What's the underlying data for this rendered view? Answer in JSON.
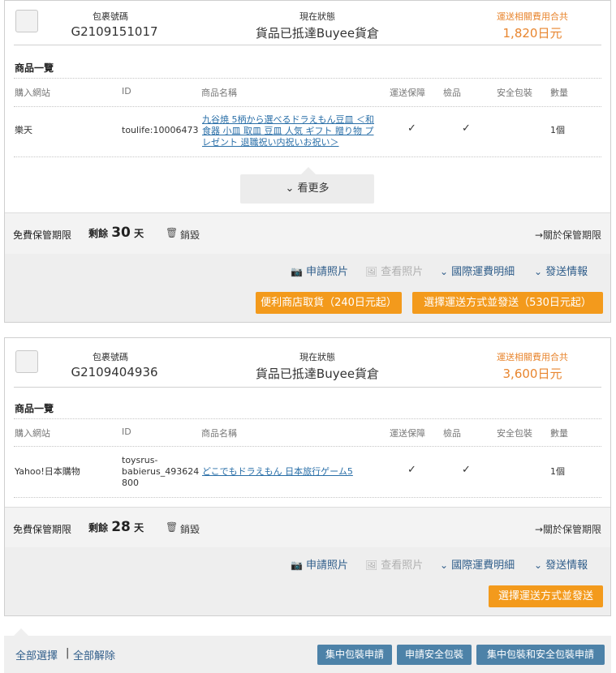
{
  "packages": [
    {
      "head": {
        "package_no_label": "包裹號碼",
        "package_no": "G2109151017",
        "status_label": "現在狀態",
        "status": "貨品已抵達Buyee貨倉",
        "fee_label": "運送相關費用合共",
        "fee": "1,820日元"
      },
      "goods_title": "商品一覽",
      "columns": [
        "購入網站",
        "ID",
        "商品名稱",
        "運送保障",
        "檢品",
        "安全包裝",
        "數量"
      ],
      "item": {
        "site": "樂天",
        "id": "toulife:10006473",
        "name_lines": [
          "九谷焼 5柄から選べるドラえもん豆皿 ＜和",
          "食器 小皿 取皿 豆皿 人気 ギフト 贈り物 プ",
          "レゼント 退職祝い内祝いお祝い＞"
        ],
        "check1": "✓",
        "check2": "✓",
        "qty": "1個"
      },
      "more_label": "看更多",
      "keep": {
        "label": "免費保管期限",
        "remain_prefix": "剩餘",
        "remain_days": "30",
        "remain_unit": "天",
        "destroy": "銷毀",
        "link": "→關於保管期限"
      },
      "actions": {
        "photo_request": "申請照片",
        "view_photo": "查看照片",
        "intl_fee": "國際運費明細",
        "ship_info": "發送情報"
      },
      "buttons": {
        "convenience": "便利商店取貨（240日元起）",
        "ship": "選擇運送方式並發送（530日元起）"
      }
    },
    {
      "head": {
        "package_no_label": "包裹號碼",
        "package_no": "G2109404936",
        "status_label": "現在狀態",
        "status": "貨品已抵達Buyee貨倉",
        "fee_label": "運送相關費用合共",
        "fee": "3,600日元"
      },
      "goods_title": "商品一覽",
      "columns": [
        "購入網站",
        "ID",
        "商品名稱",
        "運送保障",
        "檢品",
        "安全包裝",
        "數量"
      ],
      "item": {
        "site": "Yahoo!日本購物",
        "id_lines": [
          "toysrus-",
          "babierus_493624",
          "800"
        ],
        "name": "どこでもドラえもん 日本旅行ゲーム5",
        "check1": "✓",
        "check2": "✓",
        "qty": "1個"
      },
      "keep": {
        "label": "免費保管期限",
        "remain_prefix": "剩餘",
        "remain_days": "28",
        "remain_unit": "天",
        "destroy": "銷毀",
        "link": "→關於保管期限"
      },
      "actions": {
        "photo_request": "申請照片",
        "view_photo": "查看照片",
        "intl_fee": "國際運費明細",
        "ship_info": "發送情報"
      },
      "buttons": {
        "ship": "選擇運送方式並發送"
      }
    }
  ],
  "footer": {
    "select_all": "全部選擇",
    "separator": "|",
    "deselect_all": "全部解除",
    "consolidate": "集中包裝申請",
    "safe_pack": "申請安全包裝",
    "consolidate_safe": "集中包裝和安全包裝申請"
  },
  "icons": {
    "camera": "camera-icon",
    "image": "image-icon",
    "chevron": "chevron-down-icon",
    "trash": "trash-icon"
  },
  "colors": {
    "orange": "#f39a1c",
    "fee_text": "#e8852e",
    "link_blue": "#2f5d8a",
    "footer_button": "#4d82a8"
  }
}
